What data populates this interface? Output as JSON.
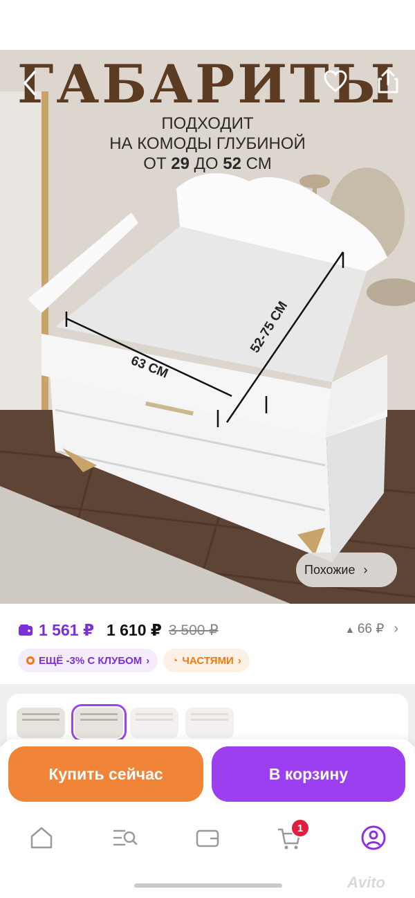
{
  "hero": {
    "title": "ГАБАРИТЫ",
    "subtitle_line1": "ПОДХОДИТ",
    "subtitle_line2": "НА КОМОДЫ ГЛУБИНОЙ",
    "line3_from": "ОТ",
    "line3_min": "29",
    "line3_to": "ДО",
    "line3_max": "52",
    "line3_unit": "СМ",
    "width_label": "63 СМ",
    "depth_label": "52-75 СМ",
    "similar_label": "Похожие"
  },
  "price": {
    "wallet": "1 561 ₽",
    "current": "1 610 ₽",
    "old": "3 500 ₽",
    "change": "66 ₽"
  },
  "badges": {
    "club": "ЕЩЁ -3% С КЛУБОМ",
    "parts": "ЧАСТЯМИ"
  },
  "actions": {
    "buy_now": "Купить сейчас",
    "add_to_cart": "В корзину"
  },
  "tabs": {
    "cart_count": "1"
  },
  "colors": {
    "accent_purple": "#9b3ff0",
    "accent_orange": "#f0853a",
    "badge_red": "#e01f3d"
  }
}
